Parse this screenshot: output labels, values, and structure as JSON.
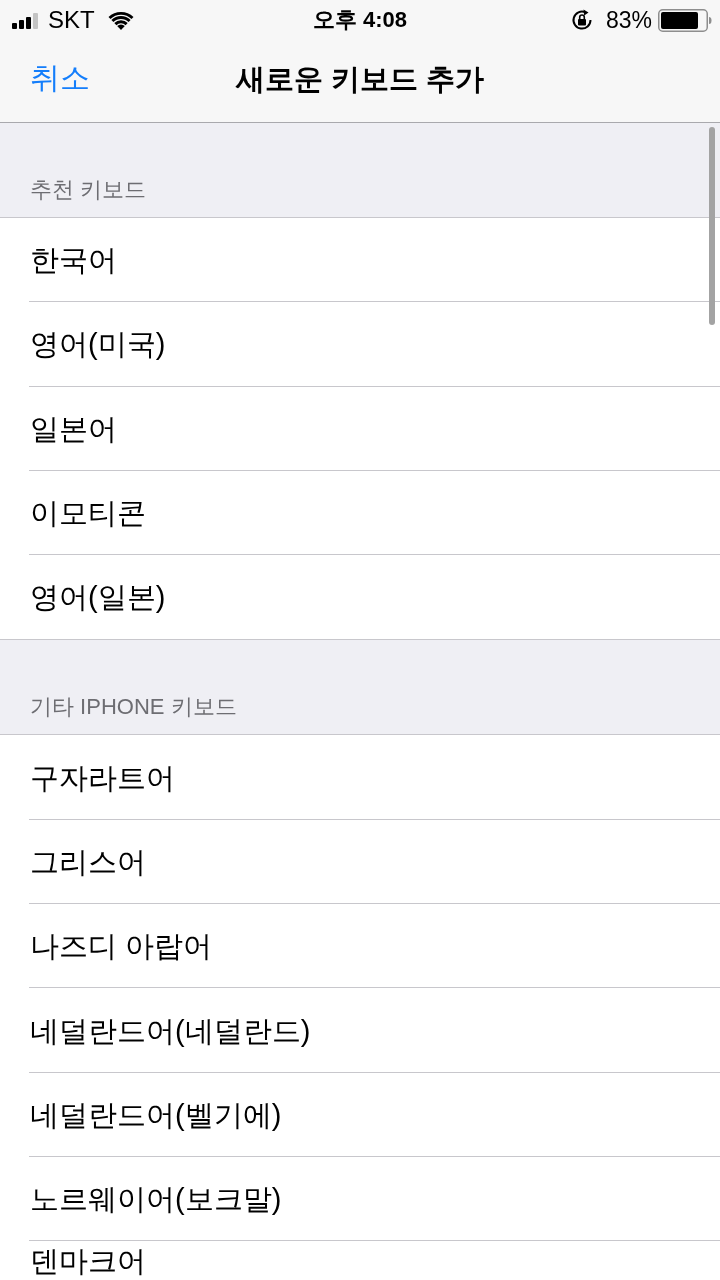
{
  "status_bar": {
    "carrier": "SKT",
    "time": "오후 4:08",
    "battery": "83%"
  },
  "nav_bar": {
    "cancel": "취소",
    "title": "새로운 키보드 추가"
  },
  "sections": [
    {
      "header": "추천 키보드",
      "items": [
        "한국어",
        "영어(미국)",
        "일본어",
        "이모티콘",
        "영어(일본)"
      ]
    },
    {
      "header": "기타 IPHONE 키보드",
      "items": [
        "구자라트어",
        "그리스어",
        "나즈디 아랍어",
        "네덜란드어(네덜란드)",
        "네덜란드어(벨기에)",
        "노르웨이어(보크말)",
        "덴마크어"
      ]
    }
  ]
}
